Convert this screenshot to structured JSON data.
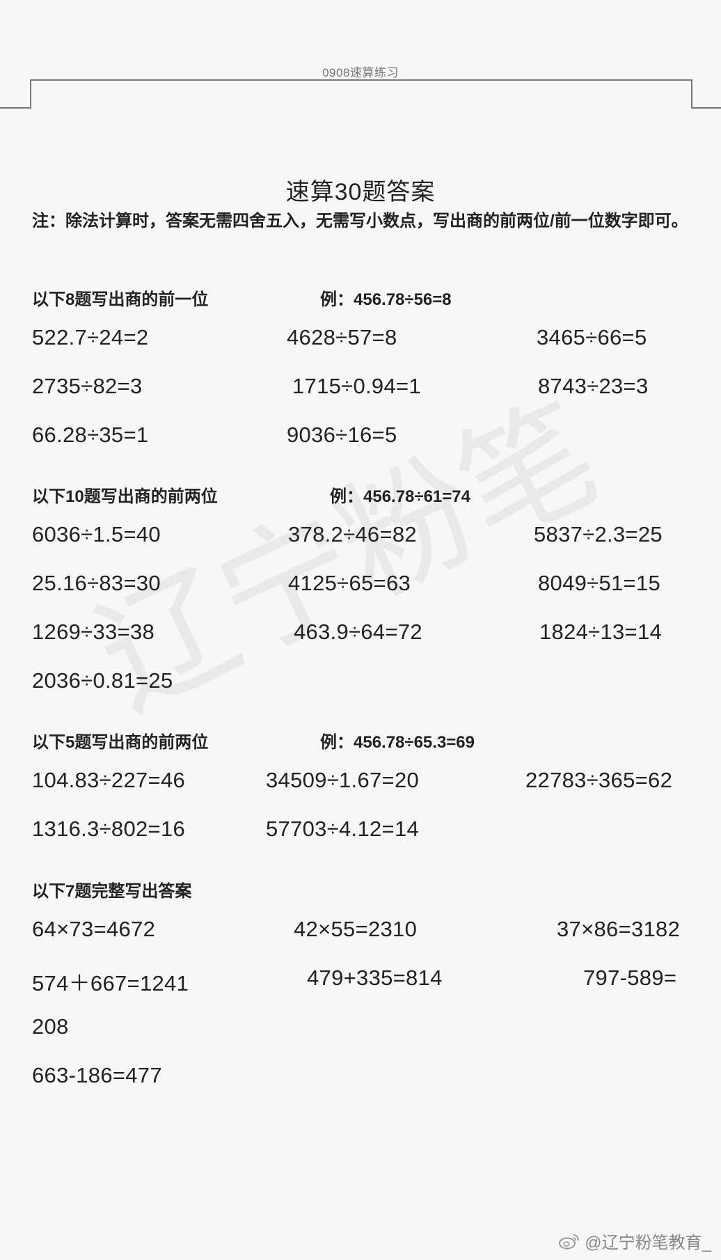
{
  "header": {
    "label": "0908速算练习"
  },
  "title": "速算30题答案",
  "note": "注：除法计算时，答案无需四舍五入，无需写小数点，写出商的前两位/前一位数字即可。",
  "sections": [
    {
      "heading": "以下8题写出商的前一位",
      "example": "例：456.78÷56=8",
      "items": [
        "522.7÷24=2",
        "4628÷57=8",
        "3465÷66=5",
        "2735÷82=3",
        "1715÷0.94=1",
        "8743÷23=3",
        "66.28÷35=1",
        "9036÷16=5"
      ]
    },
    {
      "heading": "以下10题写出商的前两位",
      "example": "例：456.78÷61=74",
      "items": [
        "6036÷1.5=40",
        "378.2÷46=82",
        "5837÷2.3=25",
        "25.16÷83=30",
        "4125÷65=63",
        "8049÷51=15",
        "1269÷33=38",
        "463.9÷64=72",
        "1824÷13=14",
        "2036÷0.81=25"
      ]
    },
    {
      "heading": "以下5题写出商的前两位",
      "example": "例：456.78÷65.3=69",
      "items": [
        "104.83÷227=46",
        "34509÷1.67=20",
        "22783÷365=62",
        "1316.3÷802=16",
        "57703÷4.12=14"
      ]
    },
    {
      "heading": "以下7题完整写出答案",
      "example": "",
      "items": [
        "64×73=4672",
        "42×55=2310",
        "37×86=3182",
        "574＋667=1241",
        "479+335=814",
        "797-589=",
        "208",
        "663-186=477"
      ]
    }
  ],
  "watermark": {
    "text": "辽宁粉笔",
    "weibo": "@辽宁粉笔教育_"
  },
  "icons": {
    "weibo": "weibo-icon"
  }
}
